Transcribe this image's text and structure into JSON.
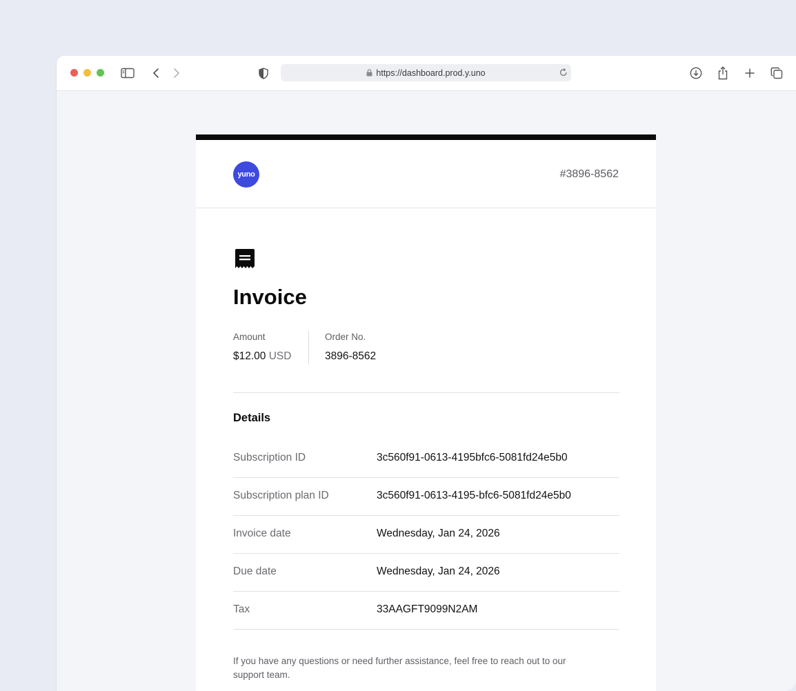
{
  "browser": {
    "url": "https://dashboard.prod.y.uno",
    "icons": [
      "sidebar-icon",
      "back-icon",
      "forward-icon",
      "shield-icon",
      "lock-icon",
      "reload-icon",
      "download-icon",
      "share-icon",
      "new-tab-icon",
      "tabs-overview-icon"
    ]
  },
  "invoice": {
    "logo_text": "yuno",
    "brand_color": "#3e49e0",
    "number": "#3896-8562",
    "title": "Invoice",
    "summary": {
      "amount_label": "Amount",
      "amount_value": "$12.00",
      "amount_currency": "USD",
      "order_label": "Order No.",
      "order_value": "3896-8562"
    },
    "details_title": "Details",
    "details": [
      {
        "key": "Subscription ID",
        "value": "3c560f91-0613-4195bfc6-5081fd24e5b0"
      },
      {
        "key": "Subscription plan ID",
        "value": "3c560f91-0613-4195-bfc6-5081fd24e5b0"
      },
      {
        "key": "Invoice date",
        "value": "Wednesday, Jan 24, 2026"
      },
      {
        "key": "Due date",
        "value": "Wednesday, Jan 24, 2026"
      },
      {
        "key": "Tax",
        "value": "33AAGFT9099N2AM"
      }
    ],
    "footer_note": "If you have any questions or need further assistance, feel free to reach out to our support team."
  }
}
